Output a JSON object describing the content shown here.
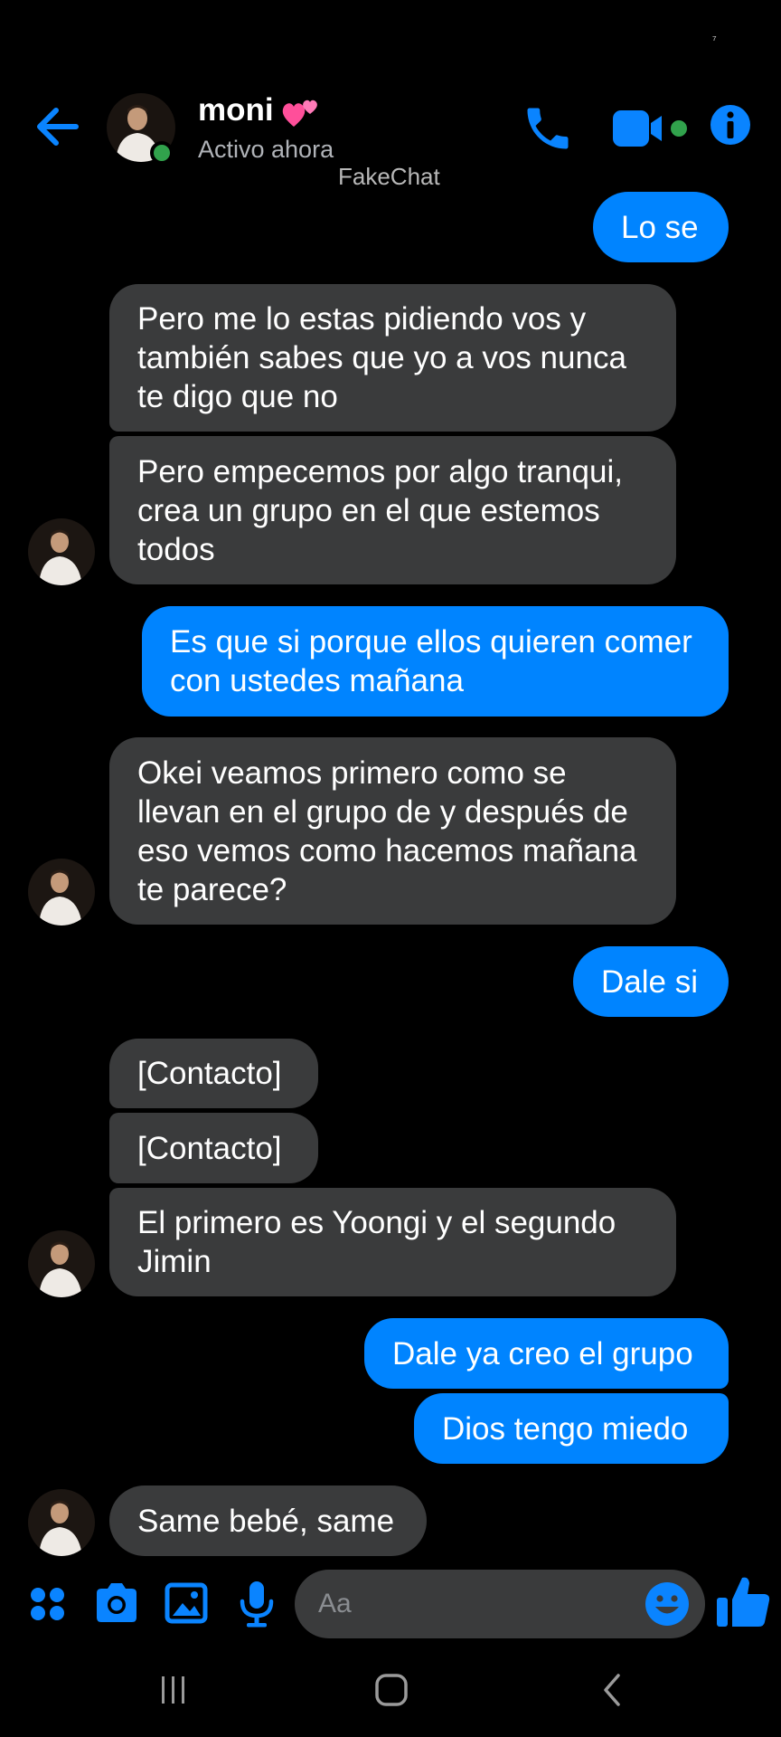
{
  "status_bar": {
    "glyph": "⁷"
  },
  "header": {
    "contact_name": "moni",
    "contact_status": "Activo ahora",
    "watermark": "FakeChat"
  },
  "messages": [
    {
      "sender": "me",
      "text": "Lo se"
    },
    {
      "sender": "them",
      "text": "Pero me lo estas pidiendo vos y también sabes que yo a vos nunca te digo que no"
    },
    {
      "sender": "them",
      "text": "Pero empecemos por algo tranqui, crea un grupo en el que estemos todos"
    },
    {
      "sender": "me",
      "text": "Es que si porque ellos quieren comer con ustedes mañana"
    },
    {
      "sender": "them",
      "text": "Okei veamos primero como se llevan en el grupo de y después de eso vemos como hacemos mañana te parece?"
    },
    {
      "sender": "me",
      "text": "Dale si"
    },
    {
      "sender": "them",
      "text": "[Contacto]"
    },
    {
      "sender": "them",
      "text": "[Contacto]"
    },
    {
      "sender": "them",
      "text": "El primero es Yoongi y el segundo Jimin"
    },
    {
      "sender": "me",
      "text": "Dale ya creo el grupo"
    },
    {
      "sender": "me",
      "text": "Dios tengo miedo"
    },
    {
      "sender": "them",
      "text": "Same bebé, same"
    }
  ],
  "composer": {
    "placeholder": "Aa"
  },
  "colors": {
    "accent": "#0084ff",
    "incoming_bubble": "#3a3b3c",
    "online": "#31a24c",
    "background": "#000000"
  },
  "icons": [
    "back-arrow-icon",
    "phone-icon",
    "video-camera-icon",
    "info-icon",
    "apps-grid-icon",
    "camera-icon",
    "gallery-icon",
    "microphone-icon",
    "emoji-icon",
    "thumbs-up-icon",
    "recents-nav-icon",
    "home-nav-icon",
    "back-nav-icon"
  ]
}
